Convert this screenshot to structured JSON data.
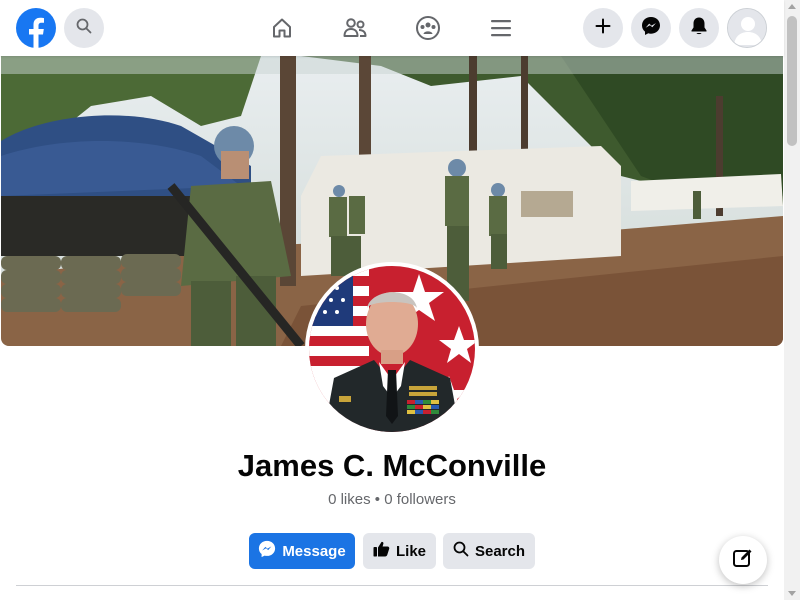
{
  "app": {
    "brand": "Facebook",
    "brand_color": "#1877f2",
    "icons": {
      "logo": "facebook-logo-icon",
      "search": "search-icon",
      "home": "home-icon",
      "friends": "friends-icon",
      "groups": "groups-icon",
      "menu": "menu-icon",
      "create": "plus-icon",
      "messenger": "messenger-icon",
      "notifications": "bell-icon",
      "account": "avatar-icon",
      "compose": "new-message-icon"
    }
  },
  "profile": {
    "name": "James C. McConville",
    "stats": "0 likes • 0 followers"
  },
  "actions": {
    "message": "Message",
    "like": "Like",
    "search": "Search"
  },
  "colors": {
    "primary": "#1b74e4",
    "secondary_bg": "#e4e6eb",
    "text": "#050505",
    "muted": "#65676b"
  }
}
